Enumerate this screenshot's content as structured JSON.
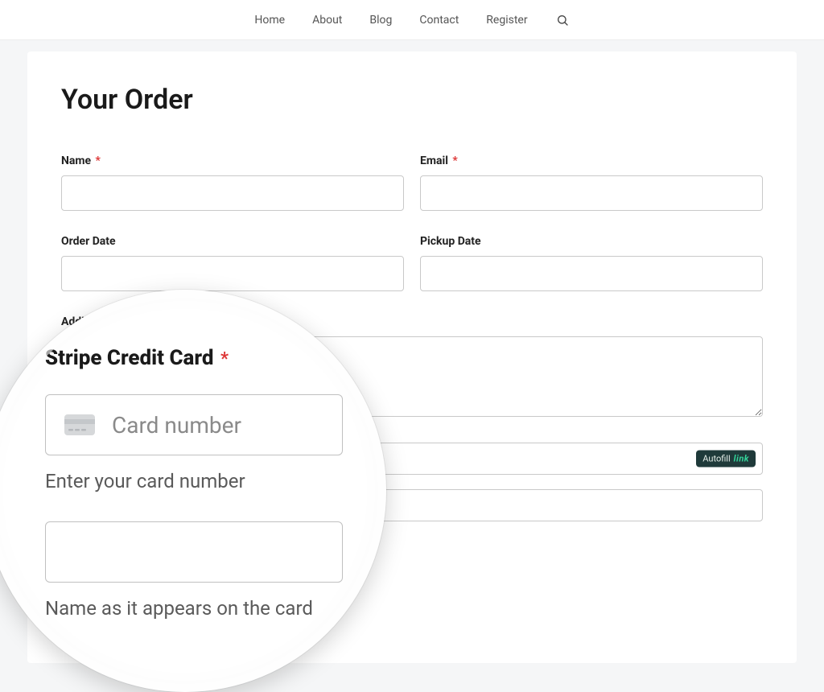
{
  "nav": {
    "items": [
      "Home",
      "About",
      "Blog",
      "Contact",
      "Register"
    ]
  },
  "page": {
    "title": "Your Order",
    "required_marker": "*"
  },
  "fields": {
    "name_label": "Name",
    "email_label": "Email",
    "order_date_label": "Order Date",
    "pickup_date_label": "Pickup Date",
    "additional_label": "Additional"
  },
  "autofill": {
    "label": "Autofill",
    "brand": "link"
  },
  "magnifier": {
    "section_title": "Stripe Credit Card",
    "card_number_placeholder": "Card number",
    "card_number_hint": "Enter your card number",
    "cardholder_hint": "Name as it appears on the card"
  }
}
